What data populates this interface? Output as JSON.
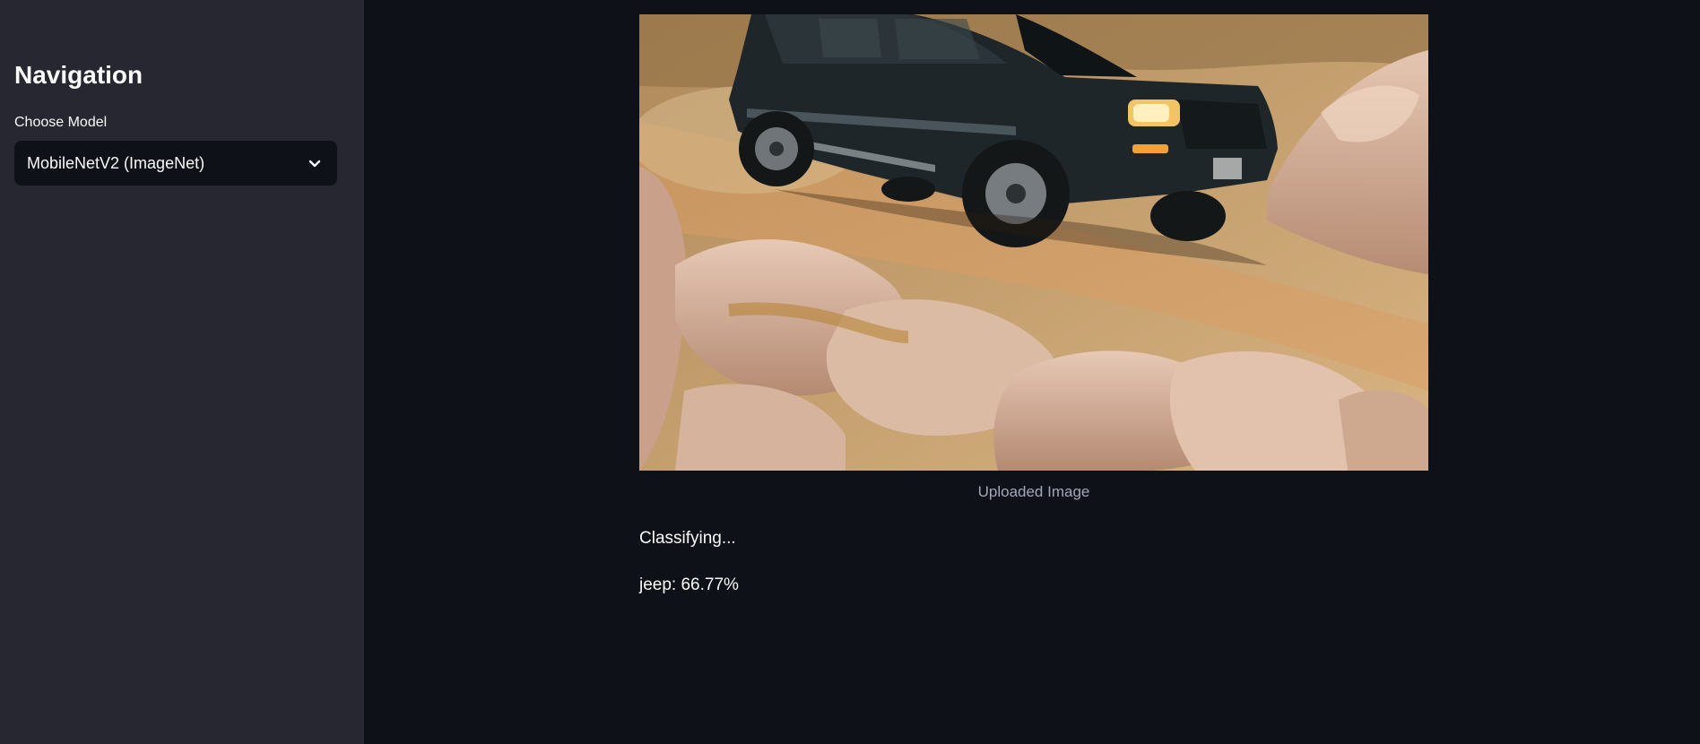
{
  "sidebar": {
    "title": "Navigation",
    "model_select": {
      "label": "Choose Model",
      "selected_value": "MobileNetV2 (ImageNet)",
      "icon": "chevron-down-icon"
    }
  },
  "main": {
    "image": {
      "caption": "Uploaded Image"
    },
    "status": "Classifying...",
    "result": "jeep: 66.77%"
  },
  "colors": {
    "app_background": "#0e1117",
    "sidebar_background": "#262730",
    "text": "#fafafa",
    "caption_text": "#a3a8b8"
  }
}
